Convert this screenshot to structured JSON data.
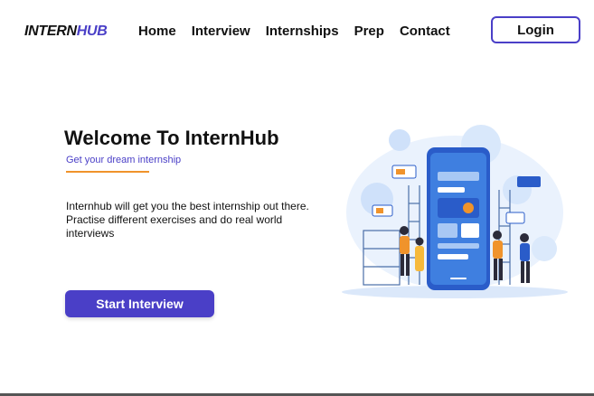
{
  "brand": {
    "part1": "INTERN",
    "part2": "HUB"
  },
  "nav": {
    "items": [
      "Home",
      "Interview",
      "Internships",
      "Prep",
      "Contact"
    ],
    "login_label": "Login"
  },
  "hero": {
    "title": "Welcome To InternHub",
    "subtitle": "Get your dream internship",
    "description": "Internhub will get you the best internship out there. Practise different exercises and do real world interviews",
    "cta_label": "Start Interview"
  },
  "illustration": {
    "icon": "smartphone-workers-illustration"
  },
  "colors": {
    "accent": "#4a3fc7",
    "underline": "#f0932b",
    "illustration_blue": "#3f7fe0"
  }
}
